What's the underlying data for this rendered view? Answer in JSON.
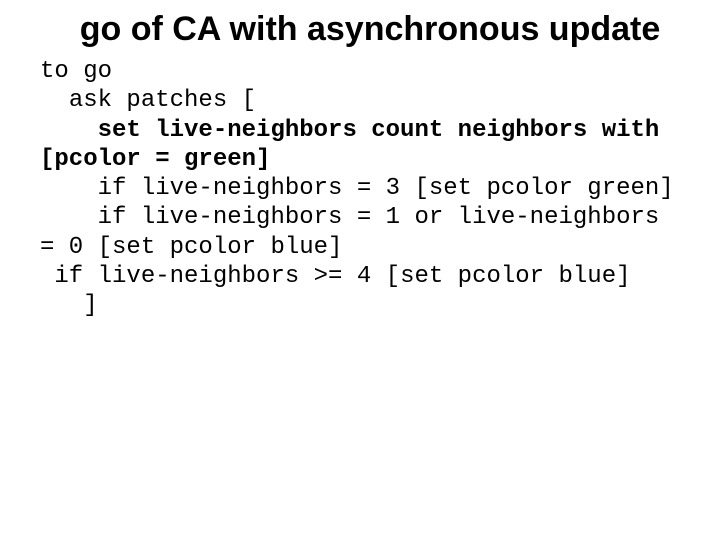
{
  "title": "go of CA with asynchronous update",
  "code": {
    "l1": "to go",
    "l2": "  ask patches [",
    "l3a": "    ",
    "l3b": "set live-neighbors count neighbors with [pcolor = green]",
    "l4": "    if live-neighbors = 3 [set pcolor green]",
    "l5": "    if live-neighbors = 1 or live-neighbors = 0 [set pcolor blue]",
    "l6": " if live-neighbors >= 4 [set pcolor blue]",
    "l7": "   ]"
  }
}
